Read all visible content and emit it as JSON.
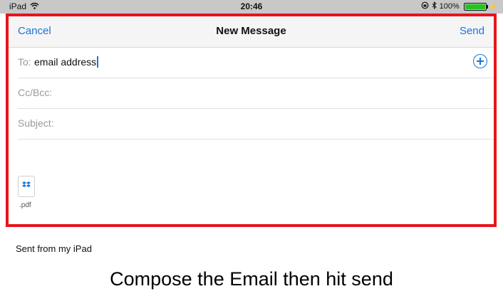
{
  "status_bar": {
    "device": "iPad",
    "time": "20:46",
    "battery": "100%",
    "battery_level": 1.0,
    "wifi_icon": "wifi-icon",
    "lock_icon": "orientation-lock-icon",
    "bluetooth_icon": "bluetooth-icon"
  },
  "nav": {
    "cancel_label": "Cancel",
    "title": "New Message",
    "send_label": "Send"
  },
  "fields": {
    "to_label": "To:",
    "to_value": "email address",
    "cc_label": "Cc/Bcc:",
    "subject_label": "Subject:"
  },
  "attachment": {
    "icon": "dropbox-icon",
    "extension": ".pdf"
  },
  "signature": "Sent from my iPad",
  "caption": "Compose the Email then hit send",
  "colors": {
    "accent": "#1a74d8",
    "highlight_border": "#e8141b"
  }
}
